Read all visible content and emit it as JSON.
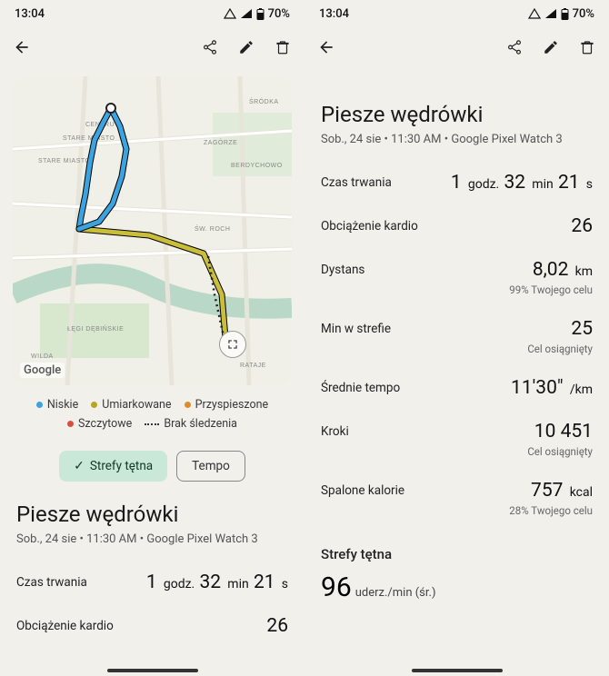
{
  "status": {
    "time": "13:04",
    "battery": "70%"
  },
  "legend": {
    "low": "Niskie",
    "moderate": "Umiarkowane",
    "accelerated": "Przyspieszone",
    "peak": "Szczytowe",
    "no_tracking": "Brak śledzenia",
    "colors": {
      "low": "#3aa3e0",
      "moderate": "#b6a61f",
      "accelerated": "#e08a2a",
      "peak": "#d7503f"
    }
  },
  "toggle": {
    "hr_zones": "Strefy tętna",
    "pace": "Tempo"
  },
  "map": {
    "attribution": "Google"
  },
  "activity": {
    "title": "Piesze wędrówki",
    "subtitle": "Sob., 24 sie • 11:30 AM • Google Pixel Watch 3"
  },
  "stats": {
    "duration": {
      "label": "Czas trwania",
      "value_parts": [
        "1",
        "godz.",
        "32",
        "min",
        "21",
        "s"
      ]
    },
    "cardio_load": {
      "label": "Obciążenie kardio",
      "value": "26"
    },
    "distance": {
      "label": "Dystans",
      "value": "8,02",
      "unit": "km",
      "note": "99% Twojego celu"
    },
    "min_in_zone": {
      "label": "Min w strefie",
      "value": "25",
      "note": "Cel osiągnięty"
    },
    "avg_pace": {
      "label": "Średnie tempo",
      "value": "11'30\"",
      "unit": "/km"
    },
    "steps": {
      "label": "Kroki",
      "value": "10 451",
      "note": "Cel osiągnięty"
    },
    "calories": {
      "label": "Spalone kalorie",
      "value": "757",
      "unit": "kcal",
      "note": "28% Twojego celu"
    }
  },
  "hr_section": {
    "title": "Strefy tętna",
    "avg_value": "96",
    "avg_unit": "uderz./min (śr.)"
  }
}
